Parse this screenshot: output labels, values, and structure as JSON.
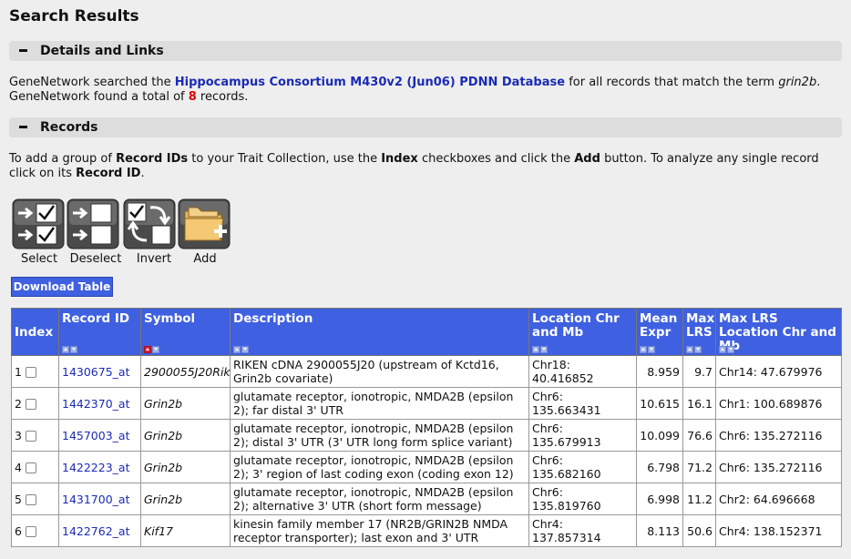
{
  "page": {
    "title": "Search Results",
    "sections": {
      "details": "Details and Links",
      "records": "Records"
    }
  },
  "details": {
    "text1": "GeneNetwork searched the ",
    "database_link": "Hippocampus Consortium M430v2 (Jun06) PDNN Database",
    "text2": " for all records that match the term ",
    "term": "grin2b",
    "text3": ".",
    "found_prefix": "GeneNetwork found a total of ",
    "count": "8",
    "found_suffix": " records."
  },
  "instructions": {
    "p1": "To add a group of ",
    "b1": "Record IDs",
    "p2": " to your Trait Collection, use the ",
    "b2": "Index",
    "p3": " checkboxes and click the ",
    "b3": "Add",
    "p4": " button. To analyze any single record click on its ",
    "b4": "Record ID",
    "p5": "."
  },
  "toolbar": {
    "select": "Select",
    "deselect": "Deselect",
    "invert": "Invert",
    "add": "Add",
    "download": "Download Table"
  },
  "table": {
    "headers": {
      "index": "Index",
      "record_id": "Record ID",
      "symbol": "Symbol",
      "description": "Description",
      "location": "Location Chr and Mb",
      "mean_expr": "Mean Expr",
      "max_lrs": "Max LRS",
      "max_lrs_location": "Max LRS Location Chr and Mb"
    },
    "rows": [
      {
        "index": "1",
        "record_id": "1430675_at",
        "symbol": "2900055J20Rik",
        "description": "RIKEN cDNA 2900055J20 (upstream of Kctd16, Grin2b covariate)",
        "location": "Chr18: 40.416852",
        "mean": "8.959",
        "lrs": "9.7",
        "lrs_loc": "Chr14: 47.679976"
      },
      {
        "index": "2",
        "record_id": "1442370_at",
        "symbol": "Grin2b",
        "description": "glutamate receptor, ionotropic, NMDA2B (epsilon 2); far distal 3' UTR",
        "location": "Chr6: 135.663431",
        "mean": "10.615",
        "lrs": "16.1",
        "lrs_loc": "Chr1: 100.689876"
      },
      {
        "index": "3",
        "record_id": "1457003_at",
        "symbol": "Grin2b",
        "description": "glutamate receptor, ionotropic, NMDA2B (epsilon 2); distal 3' UTR (3' UTR long form splice variant)",
        "location": "Chr6: 135.679913",
        "mean": "10.099",
        "lrs": "76.6",
        "lrs_loc": "Chr6: 135.272116"
      },
      {
        "index": "4",
        "record_id": "1422223_at",
        "symbol": "Grin2b",
        "description": "glutamate receptor, ionotropic, NMDA2B (epsilon 2); 3' region of last coding exon (coding exon 12)",
        "location": "Chr6: 135.682160",
        "mean": "6.798",
        "lrs": "71.2",
        "lrs_loc": "Chr6: 135.272116"
      },
      {
        "index": "5",
        "record_id": "1431700_at",
        "symbol": "Grin2b",
        "description": "glutamate receptor, ionotropic, NMDA2B (epsilon 2); alternative 3' UTR (short form message)",
        "location": "Chr6: 135.819760",
        "mean": "6.998",
        "lrs": "11.2",
        "lrs_loc": "Chr2: 64.696668"
      },
      {
        "index": "6",
        "record_id": "1422762_at",
        "symbol": "Kif17",
        "description": "kinesin family member 17 (NR2B/GRIN2B NMDA receptor transporter); last exon and 3' UTR",
        "location": "Chr4: 137.857314",
        "mean": "8.113",
        "lrs": "50.6",
        "lrs_loc": "Chr4: 138.152371"
      }
    ]
  }
}
